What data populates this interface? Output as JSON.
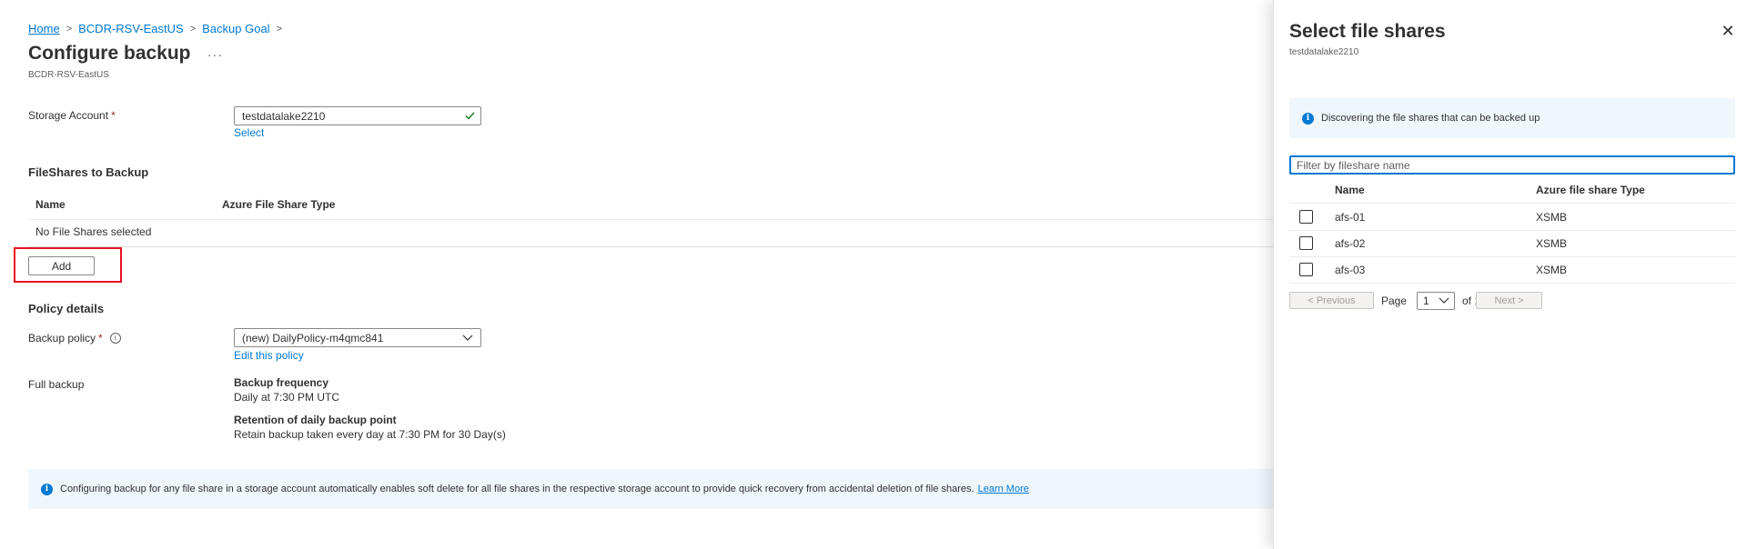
{
  "breadcrumb": {
    "items": [
      "Home",
      "BCDR-RSV-EastUS",
      "Backup Goal"
    ],
    "separator": ">"
  },
  "page": {
    "title": "Configure backup",
    "more": "···",
    "subtitle": "BCDR-RSV-EastUS"
  },
  "storage_account": {
    "label": "Storage Account",
    "required_marker": "*",
    "value": "testdatalake2210",
    "select_link": "Select"
  },
  "fileshares": {
    "section_title": "FileShares to Backup",
    "columns": [
      "Name",
      "Azure File Share Type"
    ],
    "empty_text": "No File Shares selected",
    "add_button": "Add"
  },
  "policy": {
    "section_title": "Policy details",
    "backup_policy_label": "Backup policy",
    "required_marker": "*",
    "selected": "(new) DailyPolicy-m4qmc841",
    "edit_link": "Edit this policy",
    "full_backup_label": "Full backup",
    "frequency_title": "Backup frequency",
    "frequency_value": "Daily at 7:30 PM UTC",
    "retention_title": "Retention of daily backup point",
    "retention_value": "Retain backup taken every day at 7:30 PM for 30 Day(s)"
  },
  "info_banner": {
    "message": "Configuring backup for any file share in a storage account automatically enables soft delete for all file shares in the respective storage account to provide quick recovery from accidental deletion of file shares.",
    "link": "Learn More"
  },
  "blade": {
    "title": "Select file shares",
    "subtitle": "testdatalake2210",
    "close_symbol": "✕",
    "info_message": "Discovering the file shares that can be backed up",
    "filter_placeholder": "Filter by fileshare name",
    "columns": [
      "Name",
      "Azure file share Type"
    ],
    "rows": [
      {
        "name": "afs-01",
        "type": "XSMB"
      },
      {
        "name": "afs-02",
        "type": "XSMB"
      },
      {
        "name": "afs-03",
        "type": "XSMB"
      }
    ],
    "pager": {
      "previous": "< Previous",
      "page_label": "Page",
      "current_page": "1",
      "of_label": "of 1",
      "next": "Next >"
    }
  },
  "colors": {
    "accent": "#0078d4",
    "highlight": "#e81123",
    "info_bg": "#eff6fc",
    "valid": "#107c10"
  },
  "icons": [
    "chevron-right-icon",
    "check-icon",
    "chevron-down-icon",
    "info-icon",
    "close-icon"
  ]
}
